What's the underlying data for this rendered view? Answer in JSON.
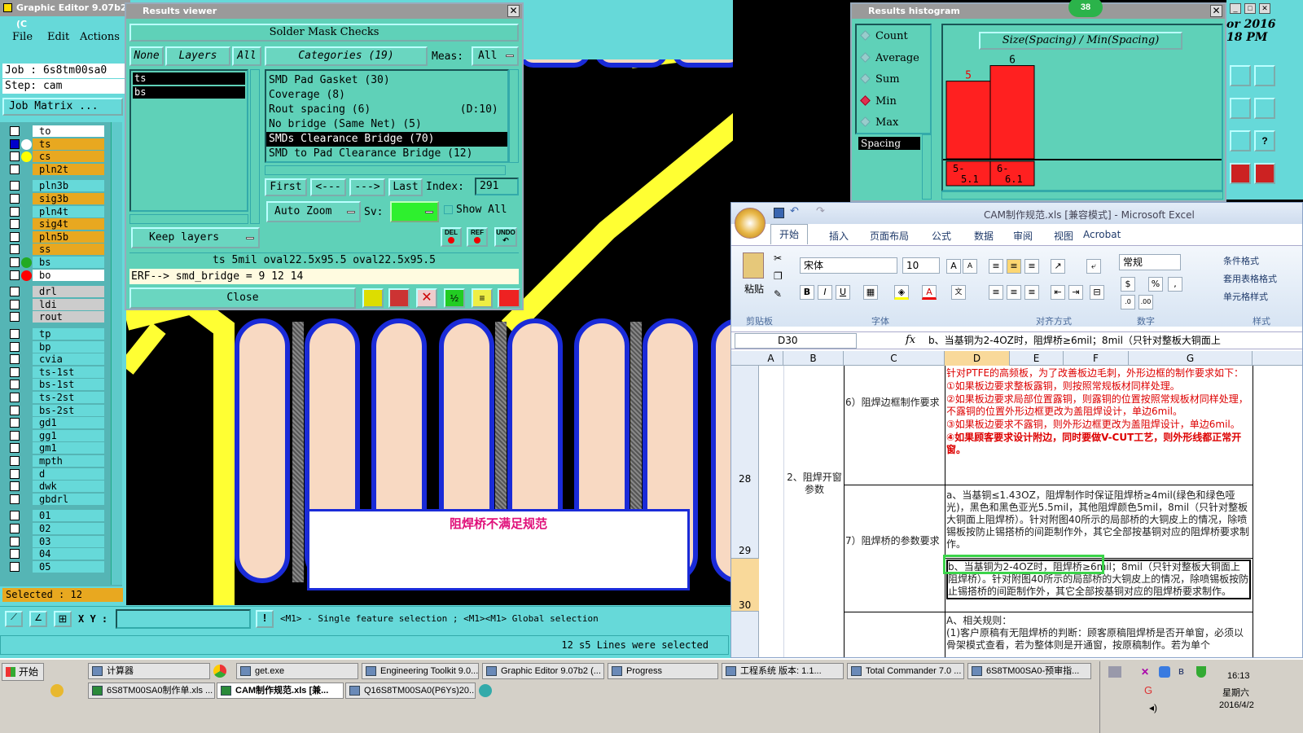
{
  "editor": {
    "title": "Graphic Editor 9.07b2 (C",
    "menu": [
      "File",
      "Edit",
      "Actions"
    ],
    "job_label": "Job : 6s8tm00sa0",
    "step_label": "Step: cam",
    "job_matrix": "Job Matrix ...",
    "layers": [
      {
        "n": "to",
        "c": "#ffffff",
        "dot": ""
      },
      {
        "n": "ts",
        "c": "#e8a820",
        "dot": "#ffffff",
        "sel": true
      },
      {
        "n": "cs",
        "c": "#e8a820",
        "dot": "#ffff00"
      },
      {
        "n": "pln2t",
        "c": "#e8a820",
        "dot": ""
      },
      {
        "n": "pln3b",
        "c": "#66d9d9",
        "dot": ""
      },
      {
        "n": "sig3b",
        "c": "#e8a820",
        "dot": ""
      },
      {
        "n": "pln4t",
        "c": "#66d9d9",
        "dot": ""
      },
      {
        "n": "sig4t",
        "c": "#e8a820",
        "dot": ""
      },
      {
        "n": "pln5b",
        "c": "#e8a820",
        "dot": ""
      },
      {
        "n": "ss",
        "c": "#e8a820",
        "dot": ""
      },
      {
        "n": "bs",
        "c": "#66d9d9",
        "dot": "#22aa22"
      },
      {
        "n": "bo",
        "c": "#ffffff",
        "dot": "#ff0000"
      },
      {
        "n": "drl",
        "c": "#cccccc",
        "dot": ""
      },
      {
        "n": "ldi",
        "c": "#cccccc",
        "dot": ""
      },
      {
        "n": "rout",
        "c": "#cccccc",
        "dot": ""
      },
      {
        "n": "tp",
        "c": "#66d9d9",
        "dot": ""
      },
      {
        "n": "bp",
        "c": "#66d9d9",
        "dot": ""
      },
      {
        "n": "cvia",
        "c": "#66d9d9",
        "dot": ""
      },
      {
        "n": "ts-1st",
        "c": "#66d9d9",
        "dot": ""
      },
      {
        "n": "bs-1st",
        "c": "#66d9d9",
        "dot": ""
      },
      {
        "n": "ts-2st",
        "c": "#66d9d9",
        "dot": ""
      },
      {
        "n": "bs-2st",
        "c": "#66d9d9",
        "dot": ""
      },
      {
        "n": "gd1",
        "c": "#66d9d9",
        "dot": ""
      },
      {
        "n": "gg1",
        "c": "#66d9d9",
        "dot": ""
      },
      {
        "n": "gm1",
        "c": "#66d9d9",
        "dot": ""
      },
      {
        "n": "mpth",
        "c": "#66d9d9",
        "dot": ""
      },
      {
        "n": "d",
        "c": "#66d9d9",
        "dot": ""
      },
      {
        "n": "dwk",
        "c": "#66d9d9",
        "dot": ""
      },
      {
        "n": "gbdrl",
        "c": "#66d9d9",
        "dot": ""
      },
      {
        "n": "01",
        "c": "#66d9d9",
        "dot": ""
      },
      {
        "n": "02",
        "c": "#66d9d9",
        "dot": ""
      },
      {
        "n": "03",
        "c": "#66d9d9",
        "dot": ""
      },
      {
        "n": "04",
        "c": "#66d9d9",
        "dot": ""
      },
      {
        "n": "05",
        "c": "#66d9d9",
        "dot": ""
      }
    ],
    "selected": "Selected : 12",
    "xy_label": "X Y :",
    "hint": "<M1> - Single feature selection ; <M1><M1> Global selection",
    "status": "12 s5 Lines were selected",
    "annotation": "阻焊桥不满足规范"
  },
  "results": {
    "title": "Results viewer",
    "header": "Solder Mask Checks",
    "none": "None",
    "layers": "Layers",
    "all": "All",
    "layer_items": [
      "ts",
      "bs"
    ],
    "categories": "Categories (19)",
    "meas_label": "Meas:",
    "meas_value": "All",
    "cats": [
      "SMD Pad Gasket (30)",
      "Coverage (8)",
      "Rout spacing (6)              (D:10)",
      "No bridge (Same Net) (5)",
      "SMDs Clearance Bridge (70)",
      "SMD to Pad Clearance Bridge (12)"
    ],
    "first": "First",
    "prev": "<---",
    "next": "--->",
    "last": "Last",
    "index_label": "Index:",
    "index_value": "291",
    "auto_zoom": "Auto Zoom",
    "sv_label": "Sv:",
    "show_all": "Show All",
    "keep_layers": "Keep layers",
    "del": "DEL",
    "ref": "REF",
    "undo": "UNDO",
    "info": "ts 5mil   oval22.5x95.5   oval22.5x95.5",
    "erf": "ERF--> smd_bridge = 9 12 14",
    "close": "Close"
  },
  "histogram": {
    "title": "Results histogram",
    "badge": "38",
    "options": [
      "Count",
      "Average",
      "Sum",
      "Min",
      "Max"
    ],
    "selected": "Min",
    "spacing": "Spacing",
    "chart_title": "Size(Spacing) / Min(Spacing)",
    "bg_text": [
      "or 2016",
      "18 PM"
    ]
  },
  "chart_data": {
    "type": "bar",
    "title": "Size(Spacing) / Min(Spacing)",
    "categories": [
      "5-\n5.1",
      "6-\n6.1"
    ],
    "values": [
      5,
      6
    ],
    "ylim": [
      0,
      6.5
    ]
  },
  "excel": {
    "title": "CAM制作规范.xls [兼容模式] - Microsoft Excel",
    "tabs": [
      "开始",
      "插入",
      "页面布局",
      "公式",
      "数据",
      "审阅",
      "视图",
      "Acrobat"
    ],
    "font": "宋体",
    "size": "10",
    "number_format": "常规",
    "groups": [
      "剪贴板",
      "字体",
      "对齐方式",
      "数字",
      "样式"
    ],
    "paste": "粘贴",
    "styles": [
      "条件格式",
      "套用表格格式",
      "单元格样式"
    ],
    "namebox": "D30",
    "formula": "b、当基铜为2-4OZ时，阻焊桥≥6mil；8mil（只针对整板大铜面上",
    "cols": [
      "A",
      "B",
      "C",
      "D",
      "E",
      "F",
      "G"
    ],
    "rows": [
      "28",
      "29",
      "30"
    ],
    "b28": "2、阻焊开窗参数",
    "c28": "6）阻焊边框制作要求",
    "c29": "7）阻焊桥的参数要求",
    "d28": [
      "针对PTFE的高频板，为了改善板边毛刺，外形边框的制作要求如下：",
      "①如果板边要求整板露铜，则按照常规板材同样处理。",
      "②如果板边要求局部位置露铜，则露铜的位置按照常规板材同样处理，不露铜的位置外形边框更改为盖阻焊设计，单边6mil。",
      "③如果板边要求不露铜，则外形边框更改为盖阻焊设计，单边6mil。",
      "④如果顾客要求设计附边，同时要做V-CUT工艺，则外形线都正常开窗。"
    ],
    "d29": "a、当基铜≤1.43OZ，阻焊制作时保证阻焊桥≥4mil(绿色和绿色哑光)，黑色和黑色亚光5.5mil，其他阻焊颜色5mil，8mil（只针对整板大铜面上阻焊桥）。针对附图40所示的局部桥的大铜皮上的情况，除喷锡板按防止锡搭桥的间距制作外，其它全部按基铜对应的阻焊桥要求制作。",
    "d30": "b、当基铜为2-4OZ时，阻焊桥≥6mil；8mil（只针对整板大铜面上阻焊桥）。针对附图40所示的局部桥的大铜皮上的情况，除喷锡板按防止锡搭桥的间距制作外，其它全部按基铜对应的阻焊桥要求制作。",
    "d31": [
      "A、相关规则：",
      "(1)客户原稿有无阻焊桥的判断：顾客原稿阻焊桥是否开单窗，必须以骨架模式查看，若为整体则是开通窗，按原稿制作。若为单个"
    ]
  },
  "taskbar": {
    "start": "开始",
    "row1": [
      "计算器",
      "get.exe",
      "Engineering Toolkit 9.0...",
      "Graphic Editor 9.07b2 (...",
      "Progress",
      "工程系统  版本: 1.1...",
      "Total Commander 7.0 ...",
      "6S8TM00SA0-预审指..."
    ],
    "row2": [
      "6S8TM00SA0制作单.xls ...",
      "CAM制作规范.xls [兼...",
      "Q16S8TM00SA0(P6Ys)20..."
    ],
    "time": "16:13",
    "weekday": "星期六",
    "date": "2016/4/2"
  },
  "colors": {
    "teal": "#66d9d9",
    "panel": "#5fd1b8",
    "pad": "#f8d9c2",
    "outline": "#1a2bd8",
    "trace": "#ffff33",
    "bar": "#ff2020"
  }
}
